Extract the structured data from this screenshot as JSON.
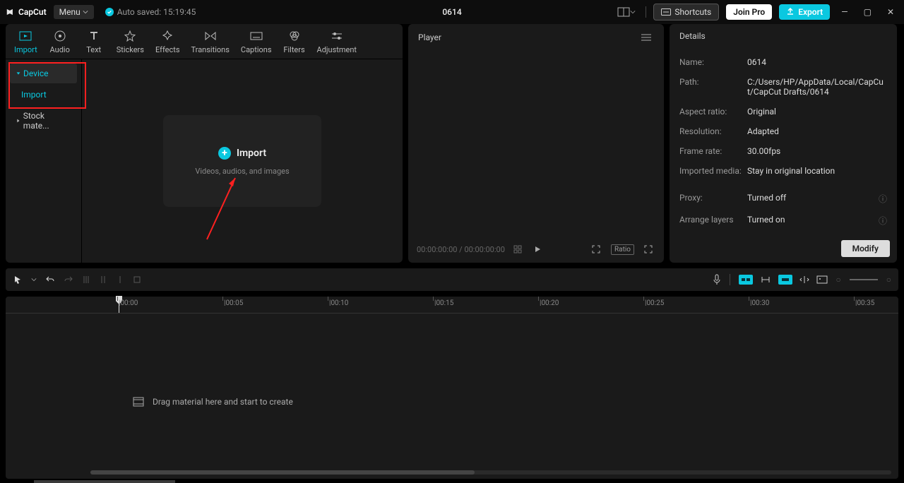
{
  "app": {
    "name": "CapCut",
    "menu": "Menu",
    "autosave": "Auto saved: 15:19:45",
    "title": "0614"
  },
  "titleRight": {
    "shortcuts": "Shortcuts",
    "joinPro": "Join Pro",
    "export": "Export"
  },
  "tabs": [
    "Import",
    "Audio",
    "Text",
    "Stickers",
    "Effects",
    "Transitions",
    "Captions",
    "Filters",
    "Adjustment"
  ],
  "sidebar": {
    "device": "Device",
    "import": "Import",
    "stock": "Stock mate..."
  },
  "importArea": {
    "title": "Import",
    "subtitle": "Videos, audios, and images"
  },
  "player": {
    "label": "Player",
    "time": "00:00:00:00 / 00:00:00:00",
    "ratio": "Ratio"
  },
  "details": {
    "title": "Details",
    "rows": {
      "name": {
        "label": "Name:",
        "value": "0614"
      },
      "path": {
        "label": "Path:",
        "value": "C:/Users/HP/AppData/Local/CapCut/CapCut Drafts/0614"
      },
      "aspect": {
        "label": "Aspect ratio:",
        "value": "Original"
      },
      "resolution": {
        "label": "Resolution:",
        "value": "Adapted"
      },
      "framerate": {
        "label": "Frame rate:",
        "value": "30.00fps"
      },
      "imported": {
        "label": "Imported media:",
        "value": "Stay in original location"
      },
      "proxy": {
        "label": "Proxy:",
        "value": "Turned off"
      },
      "arrange": {
        "label": "Arrange layers",
        "value": "Turned on"
      }
    },
    "modify": "Modify"
  },
  "timeline": {
    "ticks": [
      "|00:00",
      "|00:05",
      "|00:10",
      "|00:15",
      "|00:20",
      "|00:25",
      "|00:30",
      "|00:35"
    ],
    "dropHint": "Drag material here and start to create"
  }
}
